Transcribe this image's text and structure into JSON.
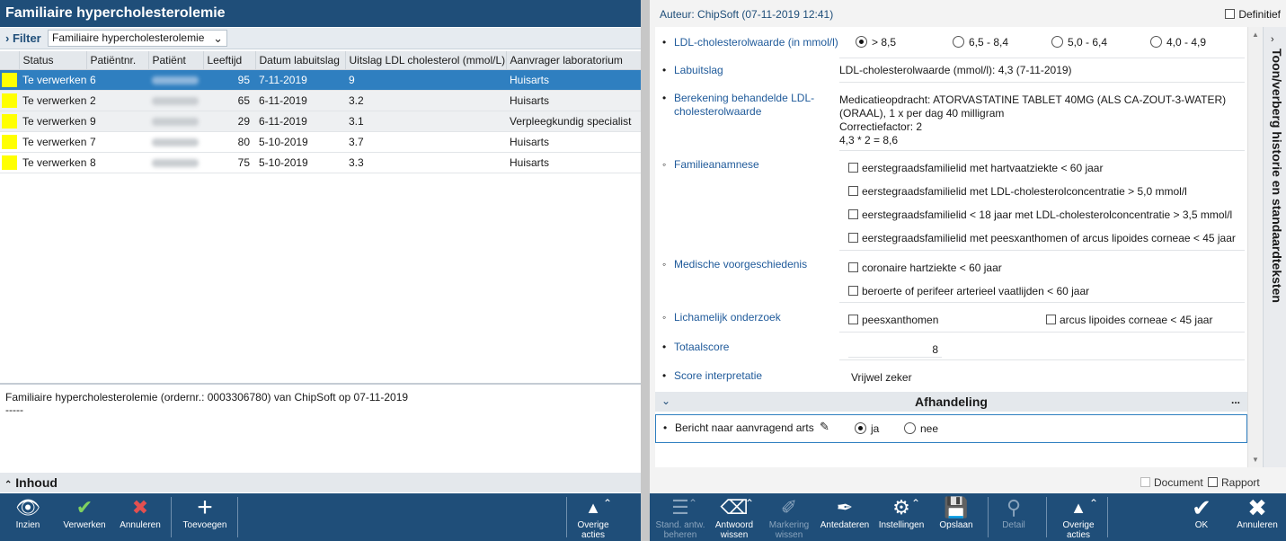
{
  "left": {
    "title": "Familiaire hypercholesterolemie",
    "filter": {
      "label": "Filter",
      "value": "Familiaire hypercholesterolemie"
    },
    "columns": [
      "Status",
      "Patiëntnr.",
      "Patiënt",
      "Leeftijd",
      "Datum labuitslag",
      "Uitslag LDL cholesterol (mmol/L)",
      "Aanvrager laboratorium"
    ],
    "rows": [
      {
        "status": "Te verwerken",
        "patnr": "6",
        "age": "95",
        "date": "7-11-2019",
        "ldl": "9",
        "requester": "Huisarts",
        "selected": true
      },
      {
        "status": "Te verwerken",
        "patnr": "2",
        "age": "65",
        "date": "6-11-2019",
        "ldl": "3.2",
        "requester": "Huisarts"
      },
      {
        "status": "Te verwerken",
        "patnr": "9",
        "age": "29",
        "date": "6-11-2019",
        "ldl": "3.1",
        "requester": "Verpleegkundig specialist"
      },
      {
        "status": "Te verwerken",
        "patnr": "7",
        "age": "80",
        "date": "5-10-2019",
        "ldl": "3.7",
        "requester": "Huisarts"
      },
      {
        "status": "Te verwerken",
        "patnr": "8",
        "age": "75",
        "date": "5-10-2019",
        "ldl": "3.3",
        "requester": "Huisarts"
      }
    ],
    "detail_line1": "Familiaire hypercholesterolemie (ordernr.: 0003306780) van ChipSoft op 07-11-2019",
    "detail_line2": "-----",
    "inhoud": "Inhoud",
    "toolbar": {
      "inzien": "Inzien",
      "verwerken": "Verwerken",
      "annuleren": "Annuleren",
      "toevoegen": "Toevoegen",
      "overige_1": "Overige",
      "overige_2": "acties"
    }
  },
  "right": {
    "auteur": "Auteur: ChipSoft (07-11-2019 12:41)",
    "definitief": "Definitief",
    "side_tab": "Toon/verberg historie en standaardteksten",
    "form": {
      "ldl_q": "LDL-cholesterolwaarde (in mmol/l)",
      "ldl_opts": [
        "> 8,5",
        "6,5 - 8,4",
        "5,0 - 6,4",
        "4,0 - 4,9"
      ],
      "lab_q": "Labuitslag",
      "lab_a": "LDL-cholesterolwaarde (mmol/l): 4,3 (7-11-2019)",
      "calc_q1": "Berekening behandelde LDL-",
      "calc_q2": "cholesterolwaarde",
      "calc_a1": "Medicatieopdracht: ATORVASTATINE TABLET 40MG (ALS CA-ZOUT-3-WATER)",
      "calc_a2": "(ORAAL), 1 x per dag 40 milligram",
      "calc_a3": "Correctiefactor: 2",
      "calc_a4": "4,3 * 2 = 8,6",
      "fam_q": "Familieanamnese",
      "fam_opts": [
        "eerstegraadsfamilielid met hartvaatziekte < 60 jaar",
        "eerstegraadsfamilielid met LDL-cholesterolconcentratie > 5,0 mmol/l",
        "eerstegraadsfamilielid < 18 jaar met LDL-cholesterolconcentratie > 3,5 mmol/l",
        "eerstegraadsfamilielid met peesxanthomen of arcus lipoides corneae < 45 jaar"
      ],
      "med_q": "Medische voorgeschiedenis",
      "med_opts": [
        "coronaire hartziekte < 60 jaar",
        "beroerte of perifeer arterieel vaatlijden < 60 jaar"
      ],
      "lich_q": "Lichamelijk onderzoek",
      "lich_opts": [
        "peesxanthomen",
        "arcus lipoides corneae < 45 jaar"
      ],
      "totaal_q": "Totaalscore",
      "totaal_a": "8",
      "score_q": "Score interpretatie",
      "score_a": "Vrijwel zeker",
      "afhandeling": "Afhandeling",
      "dots": "...",
      "bericht_q": "Bericht naar aanvragend arts",
      "bericht_opts": [
        "ja",
        "nee"
      ]
    },
    "document": "Document",
    "rapport": "Rapport",
    "toolbar": {
      "stand_1": "Stand. antw.",
      "stand_2": "beheren",
      "antw_1": "Antwoord",
      "antw_2": "wissen",
      "mark_1": "Markering",
      "mark_2": "wissen",
      "antedateren": "Antedateren",
      "instellingen": "Instellingen",
      "opslaan": "Opslaan",
      "detail": "Detail",
      "overige_1": "Overige",
      "overige_2": "acties",
      "ok": "OK",
      "annuleren": "Annuleren"
    }
  }
}
